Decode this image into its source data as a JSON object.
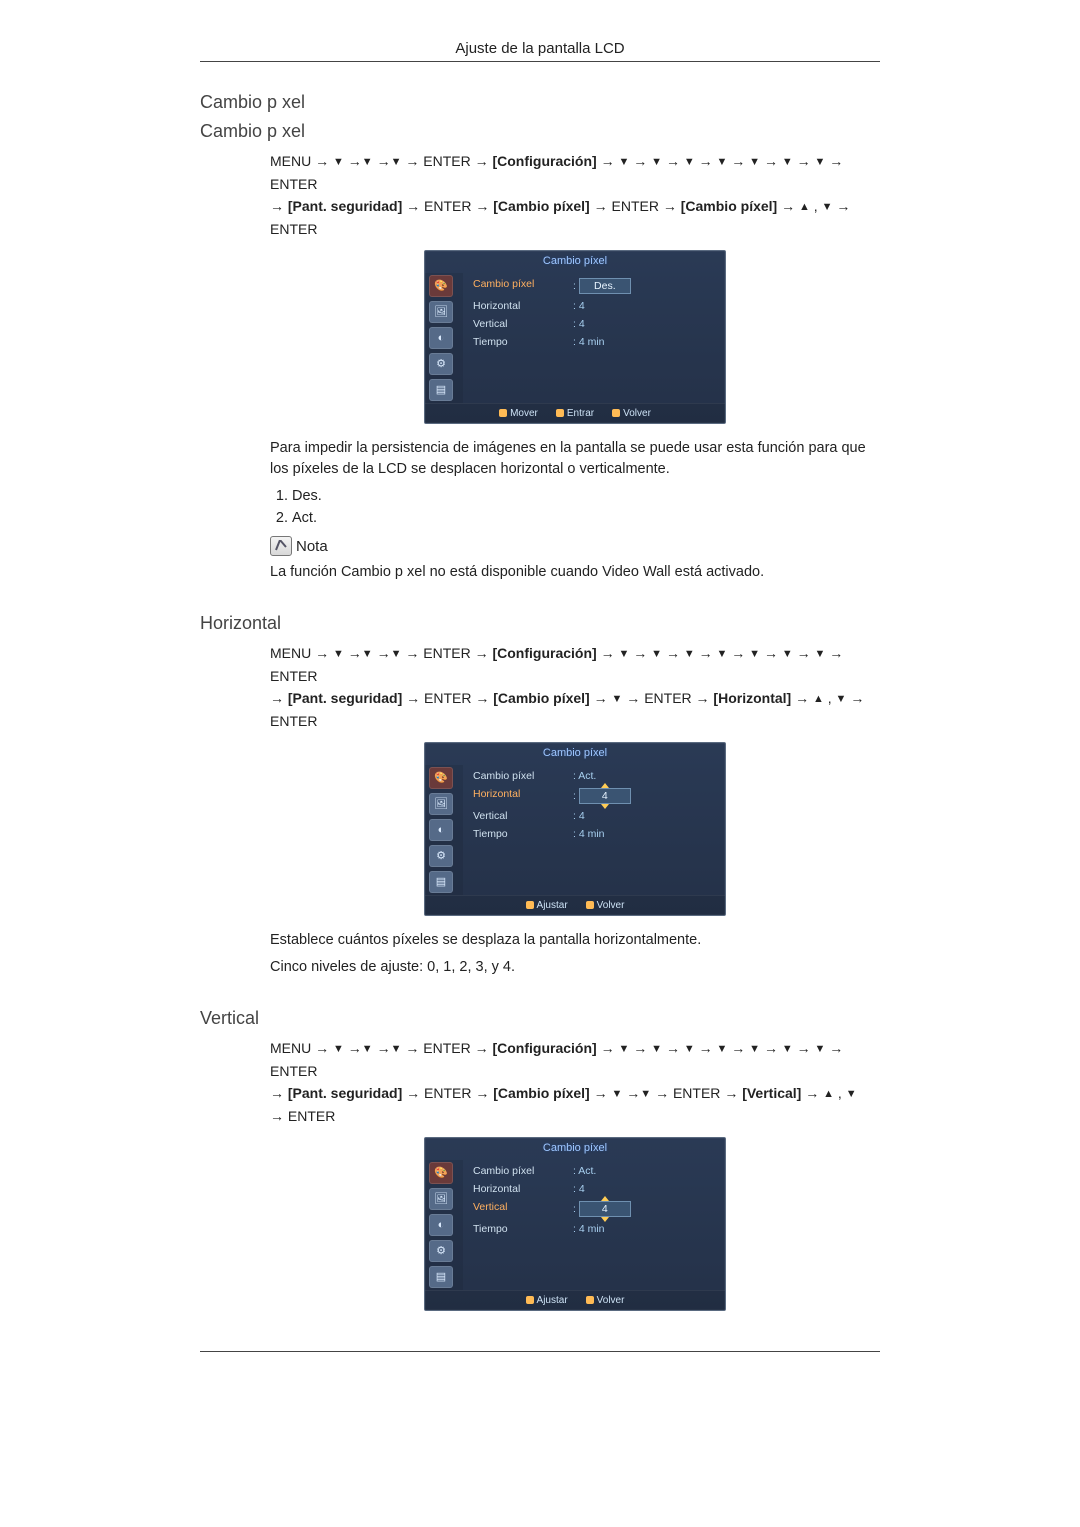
{
  "header": {
    "title": "Ajuste de la pantalla LCD"
  },
  "sections": {
    "cambio_pixel_1": {
      "title": "Cambio p xel"
    },
    "cambio_pixel_2": {
      "title": "Cambio p xel"
    },
    "horizontal": {
      "title": "Horizontal"
    },
    "vertical": {
      "title": "Vertical"
    }
  },
  "nav_tokens": {
    "menu": "MENU",
    "enter": "ENTER",
    "arrow": "→",
    "down": "▼",
    "up": "▲",
    "comma": " , ",
    "cfg": "[Configuración]",
    "seg": "[Pant. seguridad]",
    "cp": "[Cambio píxel]",
    "hor": "[Horizontal]",
    "ver": "[Vertical]"
  },
  "osd_common": {
    "title": "Cambio píxel",
    "labels": {
      "cambio_pixel": "Cambio píxel",
      "horizontal": "Horizontal",
      "vertical": "Vertical",
      "tiempo": "Tiempo"
    },
    "footer": {
      "mover": "Mover",
      "entrar": "Entrar",
      "volver": "Volver",
      "ajustar": "Ajustar"
    }
  },
  "osd1": {
    "cambio_pixel": {
      "value": "Des.",
      "options": [
        "Des.",
        "Act."
      ],
      "highlight": true
    },
    "horizontal": {
      "value": "4"
    },
    "vertical": {
      "value": "4"
    },
    "tiempo": {
      "value": "4 min"
    },
    "footer_keys": [
      "mover",
      "entrar",
      "volver"
    ]
  },
  "osd2": {
    "cambio_pixel": {
      "value": "Act."
    },
    "horizontal": {
      "value": "4",
      "editable": true
    },
    "vertical": {
      "value": "4"
    },
    "tiempo": {
      "value": "4 min"
    },
    "footer_keys": [
      "ajustar",
      "volver"
    ]
  },
  "osd3": {
    "cambio_pixel": {
      "value": "Act."
    },
    "horizontal": {
      "value": "4"
    },
    "vertical": {
      "value": "4",
      "editable": true
    },
    "tiempo": {
      "value": "4 min"
    },
    "footer_keys": [
      "ajustar",
      "volver"
    ]
  },
  "texts": {
    "desc_cambio": "Para impedir la persistencia de imágenes en la pantalla se puede usar esta función para que los píxeles de la LCD se desplacen horizontal o verticalmente.",
    "list_1": "Des.",
    "list_2": "Act.",
    "nota_label": "Nota",
    "nota_body": "La función Cambio p xel no está disponible cuando   Video Wall está activado.",
    "desc_hor_1": "Establece cuántos píxeles se desplaza la pantalla horizontalmente.",
    "desc_hor_2": "Cinco niveles de ajuste: 0, 1, 2, 3, y 4."
  }
}
